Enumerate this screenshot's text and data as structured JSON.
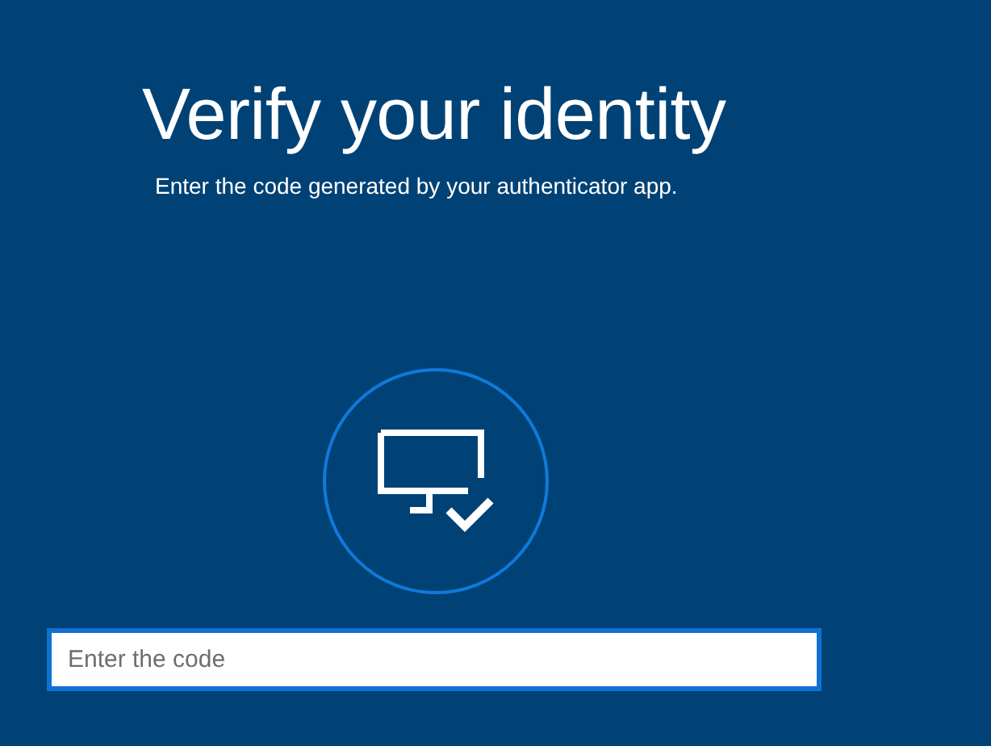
{
  "title": "Verify your identity",
  "subtitle": "Enter the code generated by your authenticator app.",
  "code_field": {
    "placeholder": "Enter the code"
  }
}
